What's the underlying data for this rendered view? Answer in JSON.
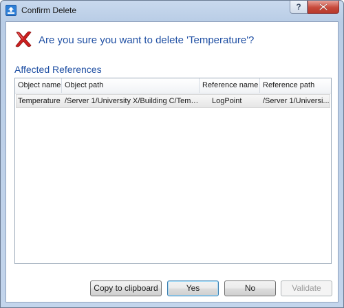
{
  "window": {
    "title": "Confirm Delete",
    "help_label": "?",
    "close_icon": "close-x-icon",
    "app_icon": "upload-arrow-icon"
  },
  "message": {
    "icon": "red-x-error-icon",
    "text": "Are you sure you want to delete 'Temperature'?"
  },
  "references": {
    "label": "Affected References",
    "columns": [
      "Object name",
      "Object path",
      "Reference name",
      "Reference path"
    ],
    "rows": [
      {
        "object_name": "Temperature",
        "object_path": "/Server 1/University X/Building C/Temp...",
        "reference_name": "LogPoint",
        "reference_path": "/Server 1/Universi..."
      }
    ]
  },
  "buttons": {
    "copy": "Copy to clipboard",
    "yes": "Yes",
    "no": "No",
    "validate": "Validate"
  },
  "colors": {
    "accent_text": "#1f4fa3",
    "close_red": "#c74a3c",
    "error_red": "#cc1f1f"
  }
}
